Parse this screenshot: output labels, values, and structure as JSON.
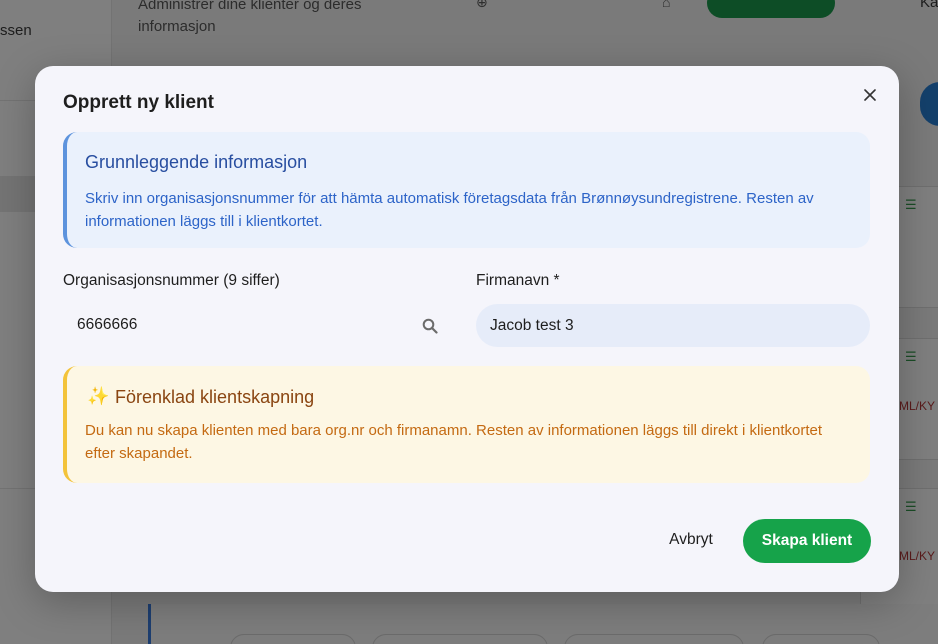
{
  "background": {
    "sidebar_text": "ssen",
    "header_subtitle_line1": "Administrer dine klienter og deres",
    "header_subtitle_line2": "informasjon",
    "top_right_text": "Ka",
    "card_tag": "ML/KY"
  },
  "modal": {
    "title": "Opprett ny klient",
    "info": {
      "title": "Grunnleggende informasjon",
      "text": "Skriv inn organisasjonsnummer för att hämta automatisk företagsdata från Brønnøysundregistrene. Resten av informationen läggs till i klientkortet."
    },
    "org_field": {
      "label": "Organisasjonsnummer (9 siffer)",
      "value": "6666666"
    },
    "name_field": {
      "label": "Firmanavn *",
      "value": "Jacob test 3"
    },
    "notice": {
      "icon": "sparkles-icon",
      "title": "Förenklad klientskapning",
      "text": "Du kan nu skapa klienten med bara org.nr och firmanamn. Resten av informationen läggs till direkt i klientkortet efter skapandet."
    },
    "actions": {
      "cancel_label": "Avbryt",
      "submit_label": "Skapa klient"
    }
  },
  "colors": {
    "primary_green": "#16a34a",
    "info_accent": "#5d93dd",
    "warning_accent": "#f3c33a"
  }
}
